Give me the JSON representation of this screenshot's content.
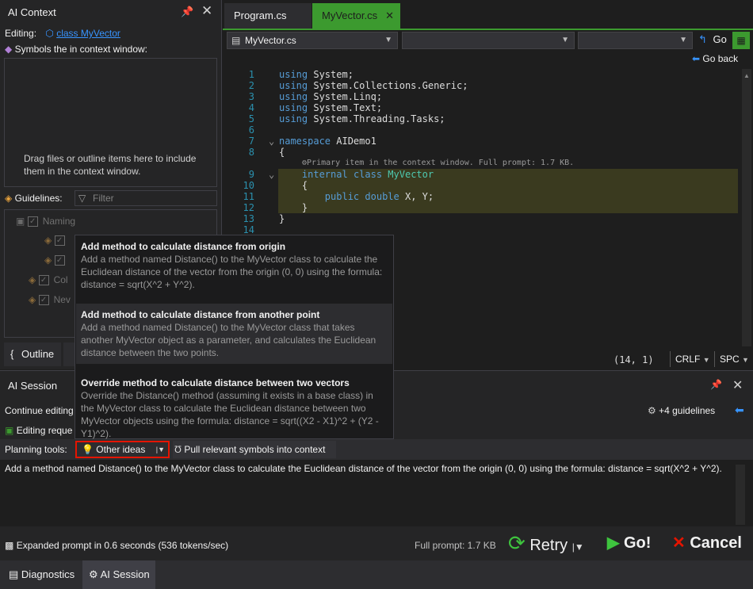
{
  "context_panel": {
    "title": "AI Context",
    "editing_label": "Editing:",
    "editing_target": "class MyVector",
    "symbols_label": "Symbols the in context window:",
    "drop_message": "Drag files or outline items here to include them in the context window.",
    "guidelines_label": "Guidelines:",
    "filter_placeholder": "Filter",
    "tree": [
      "Naming",
      "Col",
      "Nev"
    ],
    "tab_outline": "Outline"
  },
  "editor": {
    "tabs": [
      {
        "label": "Program.cs"
      },
      {
        "label": "MyVector.cs"
      }
    ],
    "nav_file": "MyVector.cs",
    "go_label": "Go",
    "go_back_label": "Go back",
    "inline_hint": "Primary item in the context window. Full prompt: 1.7 KB.",
    "line_numbers": [
      "1",
      "2",
      "3",
      "4",
      "5",
      "6",
      "7",
      "8",
      "9",
      "10",
      "11",
      "12",
      "13",
      "14"
    ],
    "status_position": "(14, 1)",
    "status_eol": "CRLF",
    "status_ws": "SPC"
  },
  "ideas": [
    {
      "title": "Add method to calculate distance from origin",
      "desc": "Add a method named Distance() to the MyVector class to calculate the Euclidean distance of the vector from the origin (0, 0) using the formula: distance = sqrt(X^2 + Y^2)."
    },
    {
      "title": "Add method to calculate distance from another point",
      "desc": "Add a method named Distance() to the MyVector class that takes another MyVector object as a parameter, and calculates the Euclidean distance between the two points."
    },
    {
      "title": "Override method to calculate distance between two vectors",
      "desc": "Override the Distance() method (assuming it exists in a base class) in the MyVector class to calculate the Euclidean distance between two MyVector objects using the formula: distance = sqrt((X2 - X1)^2 + (Y2 - Y1)^2)."
    }
  ],
  "session": {
    "title": "AI Session",
    "continue_label": "Continue editing",
    "editing_request_label": "Editing reque",
    "guidelines_count": "+4 guidelines",
    "planning_label": "Planning tools:",
    "other_ideas_label": "Other ideas",
    "pull_symbols_label": "Pull relevant symbols into context",
    "prompt_text": "Add a method named Distance() to the MyVector class to calculate the Euclidean distance of the vector from the origin (0, 0) using the formula: distance = sqrt(X^2 + Y^2).",
    "status_text": "Expanded prompt in 0.6 seconds (536 tokens/sec)",
    "full_prompt": "Full prompt: 1.7 KB",
    "retry_label": "Retry",
    "go_label": "Go!",
    "cancel_label": "Cancel"
  },
  "bottom_tabs": [
    {
      "label": "Diagnostics"
    },
    {
      "label": "AI Session"
    }
  ],
  "colors": {
    "accent": "#007acc",
    "active_tab": "#3c9a2f",
    "highlight_border": "#e51400",
    "line_highlight": "#3a3a1f"
  }
}
